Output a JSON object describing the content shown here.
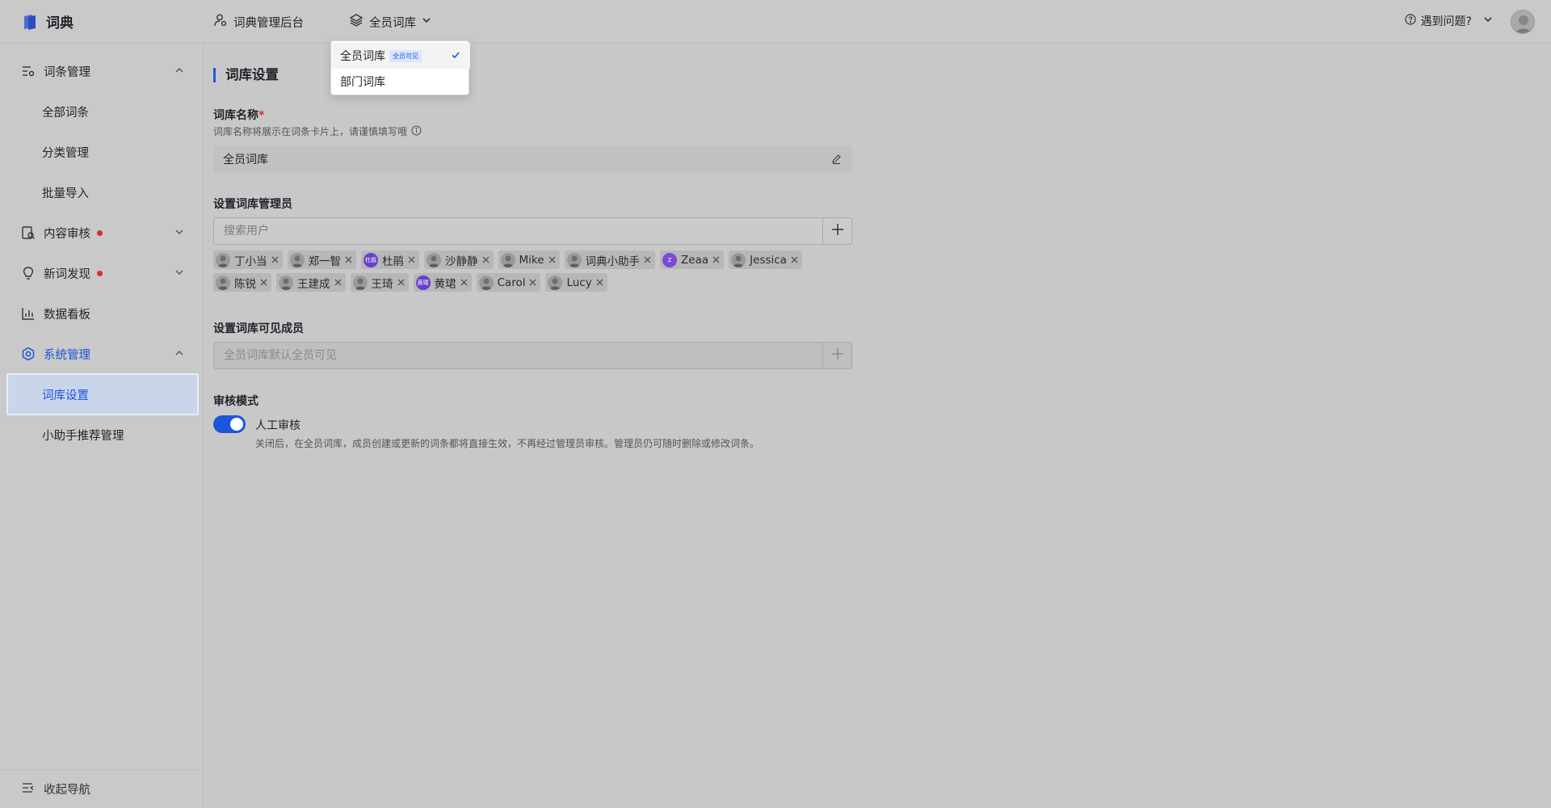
{
  "brand": {
    "title": "词典",
    "color": "#2a4dbf"
  },
  "topnav": {
    "admin_label": "词典管理后台",
    "library_label": "全员词库"
  },
  "help": {
    "label": "遇到问题?"
  },
  "sidebar": {
    "groups": [
      {
        "label": "词条管理",
        "icon": "list-settings-icon",
        "expanded": true
      },
      {
        "label": "内容审核",
        "icon": "review-icon",
        "badge_dot": true
      },
      {
        "label": "新词发现",
        "icon": "lightbulb-icon",
        "badge_dot": true
      },
      {
        "label": "数据看板",
        "icon": "bar-chart-icon"
      },
      {
        "label": "系统管理",
        "icon": "gear-icon",
        "expanded": true,
        "active": true
      }
    ],
    "subitems": {
      "terms": [
        "全部词条",
        "分类管理",
        "批量导入"
      ],
      "system": [
        "词库设置",
        "小助手推荐管理"
      ]
    },
    "active_item": "词库设置",
    "collapse_label": "收起导航"
  },
  "dropdown": {
    "options": [
      {
        "label": "全员词库",
        "badge": "全员可见",
        "selected": true
      },
      {
        "label": "部门词库",
        "selected": false
      }
    ]
  },
  "page": {
    "title": "词库设置",
    "name_label": "词库名称",
    "name_required_mark": "*",
    "name_hint": "词库名称将展示在词条卡片上，请谨慎填写哦",
    "name_value": "全员词库",
    "admins_label": "设置词库管理员",
    "admins_placeholder": "搜索用户",
    "admins": [
      "丁小当",
      "郑一智",
      "杜鹃",
      "沙静静",
      "Mike",
      "词典小助手",
      "Zeaa",
      "Jessica",
      "陈锐",
      "王建成",
      "王琦",
      "黄珺",
      "Carol",
      "Lucy"
    ],
    "admin_avatar_texts": {
      "杜鹃": "杜鹃",
      "Zeaa": "Z",
      "黄珺": "黄珺"
    },
    "members_label": "设置词库可见成员",
    "members_placeholder": "全员词库默认全员可见",
    "review_label": "审核模式",
    "review_toggle_label": "人工审核",
    "review_toggle_on": true,
    "review_desc": "关闭后，在全员词库，成员创建或更新的词条都将直接生效，不再经过管理员审核。管理员仍可随时删除或修改词条。"
  },
  "colors": {
    "accent": "#1d55d9",
    "dot": "#d93025"
  }
}
